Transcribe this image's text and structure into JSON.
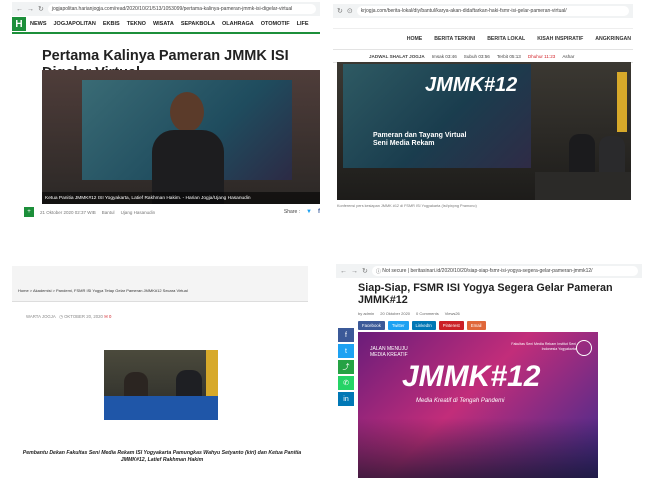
{
  "panelA": {
    "url": "jogjapolitan.harianjogja.com/read/2020/10/21/513/1053099/pertama-kalinya-pameran-jmmk-isi-digelar-virtual",
    "logo": "H",
    "menu": [
      "NEWS",
      "JOGJAPOLITAN",
      "EKBIS",
      "TEKNO",
      "WISATA",
      "SEPAKBOLA",
      "OLAHRAGA",
      "OTOMOTIF",
      "LIFE"
    ],
    "title": "Pertama Kalinya Pameran JMMK ISI Digelar Virtual",
    "photo_caption": "Ketua Panitia JMMK#12 ISI Yogyakarta, Latief Rakhman Hakim. - Harian Jogja/Ujang Hasanudin",
    "date": "21 Oktober 2020 02:37 WIB",
    "category": "Bantul",
    "author": "Ujang Hasanudin",
    "share_label": "Share :"
  },
  "panelB": {
    "url": "krjogja.com/berita-lokal/diy/bantul/karya-akan-didaftarkan-haki-fsmr-isi-gelar-pameran-virtual/",
    "menu": [
      "HOME",
      "BERITA TERKINI",
      "BERITA LOKAL",
      "KISAH INSPIRATIF",
      "ANGKRINGAN"
    ],
    "jadwal_label": "JADWAL SHALAT JOGJA",
    "times": [
      "Imsak 03:46",
      "Subuh 03:56",
      "Terbit 05:13",
      "Dhuhur 11:23",
      "Ashar"
    ],
    "screen_title": "JMMK#12",
    "screen_sub": "Pameran dan Tayang Virtual Seni Media Rekam",
    "caption": "Konferensi pers kesiapan JMMK #12 di FSMR ISI Yogyakarta (Ist/pixpng Pramono)"
  },
  "panelC": {
    "breadcrumb": "Home > Akademisi > Pandemi, FSMR ISI Yogya Tetap Gelar Pameran JMMK#12 Secara Virtual",
    "author": "WARTA JOGJA",
    "date": "OKTOBER 20, 2020",
    "comments": "0",
    "caption": "Pembantu Dekan Fakultas Seni Media Rekam ISI Yogyakarta Pamungkas Wahyu Setyanto (kiri) dan Ketua Panitia JMMK#12, Latief Rakhman Hakim"
  },
  "panelD": {
    "url": "beritasinari.id/2020/10/20/siap-siap-fsmr-isi-yogya-segera-gelar-pameran-jmmk12/",
    "secure_label": "Not secure",
    "title": "Siap-Siap, FSMR ISI Yogya Segera Gelar Pameran JMMK#12",
    "by": "by admin",
    "date": "20 Oktober 2020",
    "comments": "0 Comments",
    "views": "Views26",
    "share_buttons": [
      {
        "label": "Facebook",
        "color": "#3b5998"
      },
      {
        "label": "Twitter",
        "color": "#1da1f2"
      },
      {
        "label": "LinkedIn",
        "color": "#0077b5"
      },
      {
        "label": "Pinterest",
        "color": "#cb2027"
      },
      {
        "label": "Email",
        "color": "#e0673a"
      }
    ],
    "sidebar_icons": [
      "facebook-icon",
      "twitter-icon",
      "share-icon",
      "whatsapp-icon",
      "linkedin-icon"
    ],
    "image_title": "JMMK#12",
    "image_sub": "Media Kreatif di Tengah Pandemi",
    "image_jalan": "JALAN MENUJU MEDIA KREATIF",
    "image_fakultas": "Fakultas Seni Media Rekam Institut Seni Indonesia Yogyakarta"
  },
  "colors": {
    "harian_green": "#1c8f3a",
    "kr_red": "#d2232a",
    "poster_magenta": "#c22d7a"
  }
}
